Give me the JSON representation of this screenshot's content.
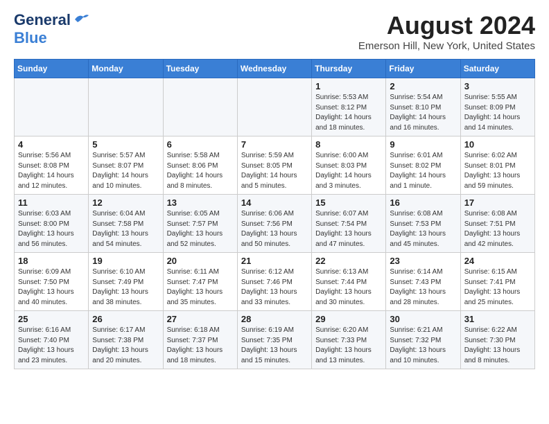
{
  "header": {
    "logo_line1": "General",
    "logo_line2": "Blue",
    "month": "August 2024",
    "location": "Emerson Hill, New York, United States"
  },
  "weekdays": [
    "Sunday",
    "Monday",
    "Tuesday",
    "Wednesday",
    "Thursday",
    "Friday",
    "Saturday"
  ],
  "weeks": [
    [
      {
        "day": "",
        "info": ""
      },
      {
        "day": "",
        "info": ""
      },
      {
        "day": "",
        "info": ""
      },
      {
        "day": "",
        "info": ""
      },
      {
        "day": "1",
        "info": "Sunrise: 5:53 AM\nSunset: 8:12 PM\nDaylight: 14 hours\nand 18 minutes."
      },
      {
        "day": "2",
        "info": "Sunrise: 5:54 AM\nSunset: 8:10 PM\nDaylight: 14 hours\nand 16 minutes."
      },
      {
        "day": "3",
        "info": "Sunrise: 5:55 AM\nSunset: 8:09 PM\nDaylight: 14 hours\nand 14 minutes."
      }
    ],
    [
      {
        "day": "4",
        "info": "Sunrise: 5:56 AM\nSunset: 8:08 PM\nDaylight: 14 hours\nand 12 minutes."
      },
      {
        "day": "5",
        "info": "Sunrise: 5:57 AM\nSunset: 8:07 PM\nDaylight: 14 hours\nand 10 minutes."
      },
      {
        "day": "6",
        "info": "Sunrise: 5:58 AM\nSunset: 8:06 PM\nDaylight: 14 hours\nand 8 minutes."
      },
      {
        "day": "7",
        "info": "Sunrise: 5:59 AM\nSunset: 8:05 PM\nDaylight: 14 hours\nand 5 minutes."
      },
      {
        "day": "8",
        "info": "Sunrise: 6:00 AM\nSunset: 8:03 PM\nDaylight: 14 hours\nand 3 minutes."
      },
      {
        "day": "9",
        "info": "Sunrise: 6:01 AM\nSunset: 8:02 PM\nDaylight: 14 hours\nand 1 minute."
      },
      {
        "day": "10",
        "info": "Sunrise: 6:02 AM\nSunset: 8:01 PM\nDaylight: 13 hours\nand 59 minutes."
      }
    ],
    [
      {
        "day": "11",
        "info": "Sunrise: 6:03 AM\nSunset: 8:00 PM\nDaylight: 13 hours\nand 56 minutes."
      },
      {
        "day": "12",
        "info": "Sunrise: 6:04 AM\nSunset: 7:58 PM\nDaylight: 13 hours\nand 54 minutes."
      },
      {
        "day": "13",
        "info": "Sunrise: 6:05 AM\nSunset: 7:57 PM\nDaylight: 13 hours\nand 52 minutes."
      },
      {
        "day": "14",
        "info": "Sunrise: 6:06 AM\nSunset: 7:56 PM\nDaylight: 13 hours\nand 50 minutes."
      },
      {
        "day": "15",
        "info": "Sunrise: 6:07 AM\nSunset: 7:54 PM\nDaylight: 13 hours\nand 47 minutes."
      },
      {
        "day": "16",
        "info": "Sunrise: 6:08 AM\nSunset: 7:53 PM\nDaylight: 13 hours\nand 45 minutes."
      },
      {
        "day": "17",
        "info": "Sunrise: 6:08 AM\nSunset: 7:51 PM\nDaylight: 13 hours\nand 42 minutes."
      }
    ],
    [
      {
        "day": "18",
        "info": "Sunrise: 6:09 AM\nSunset: 7:50 PM\nDaylight: 13 hours\nand 40 minutes."
      },
      {
        "day": "19",
        "info": "Sunrise: 6:10 AM\nSunset: 7:49 PM\nDaylight: 13 hours\nand 38 minutes."
      },
      {
        "day": "20",
        "info": "Sunrise: 6:11 AM\nSunset: 7:47 PM\nDaylight: 13 hours\nand 35 minutes."
      },
      {
        "day": "21",
        "info": "Sunrise: 6:12 AM\nSunset: 7:46 PM\nDaylight: 13 hours\nand 33 minutes."
      },
      {
        "day": "22",
        "info": "Sunrise: 6:13 AM\nSunset: 7:44 PM\nDaylight: 13 hours\nand 30 minutes."
      },
      {
        "day": "23",
        "info": "Sunrise: 6:14 AM\nSunset: 7:43 PM\nDaylight: 13 hours\nand 28 minutes."
      },
      {
        "day": "24",
        "info": "Sunrise: 6:15 AM\nSunset: 7:41 PM\nDaylight: 13 hours\nand 25 minutes."
      }
    ],
    [
      {
        "day": "25",
        "info": "Sunrise: 6:16 AM\nSunset: 7:40 PM\nDaylight: 13 hours\nand 23 minutes."
      },
      {
        "day": "26",
        "info": "Sunrise: 6:17 AM\nSunset: 7:38 PM\nDaylight: 13 hours\nand 20 minutes."
      },
      {
        "day": "27",
        "info": "Sunrise: 6:18 AM\nSunset: 7:37 PM\nDaylight: 13 hours\nand 18 minutes."
      },
      {
        "day": "28",
        "info": "Sunrise: 6:19 AM\nSunset: 7:35 PM\nDaylight: 13 hours\nand 15 minutes."
      },
      {
        "day": "29",
        "info": "Sunrise: 6:20 AM\nSunset: 7:33 PM\nDaylight: 13 hours\nand 13 minutes."
      },
      {
        "day": "30",
        "info": "Sunrise: 6:21 AM\nSunset: 7:32 PM\nDaylight: 13 hours\nand 10 minutes."
      },
      {
        "day": "31",
        "info": "Sunrise: 6:22 AM\nSunset: 7:30 PM\nDaylight: 13 hours\nand 8 minutes."
      }
    ]
  ]
}
